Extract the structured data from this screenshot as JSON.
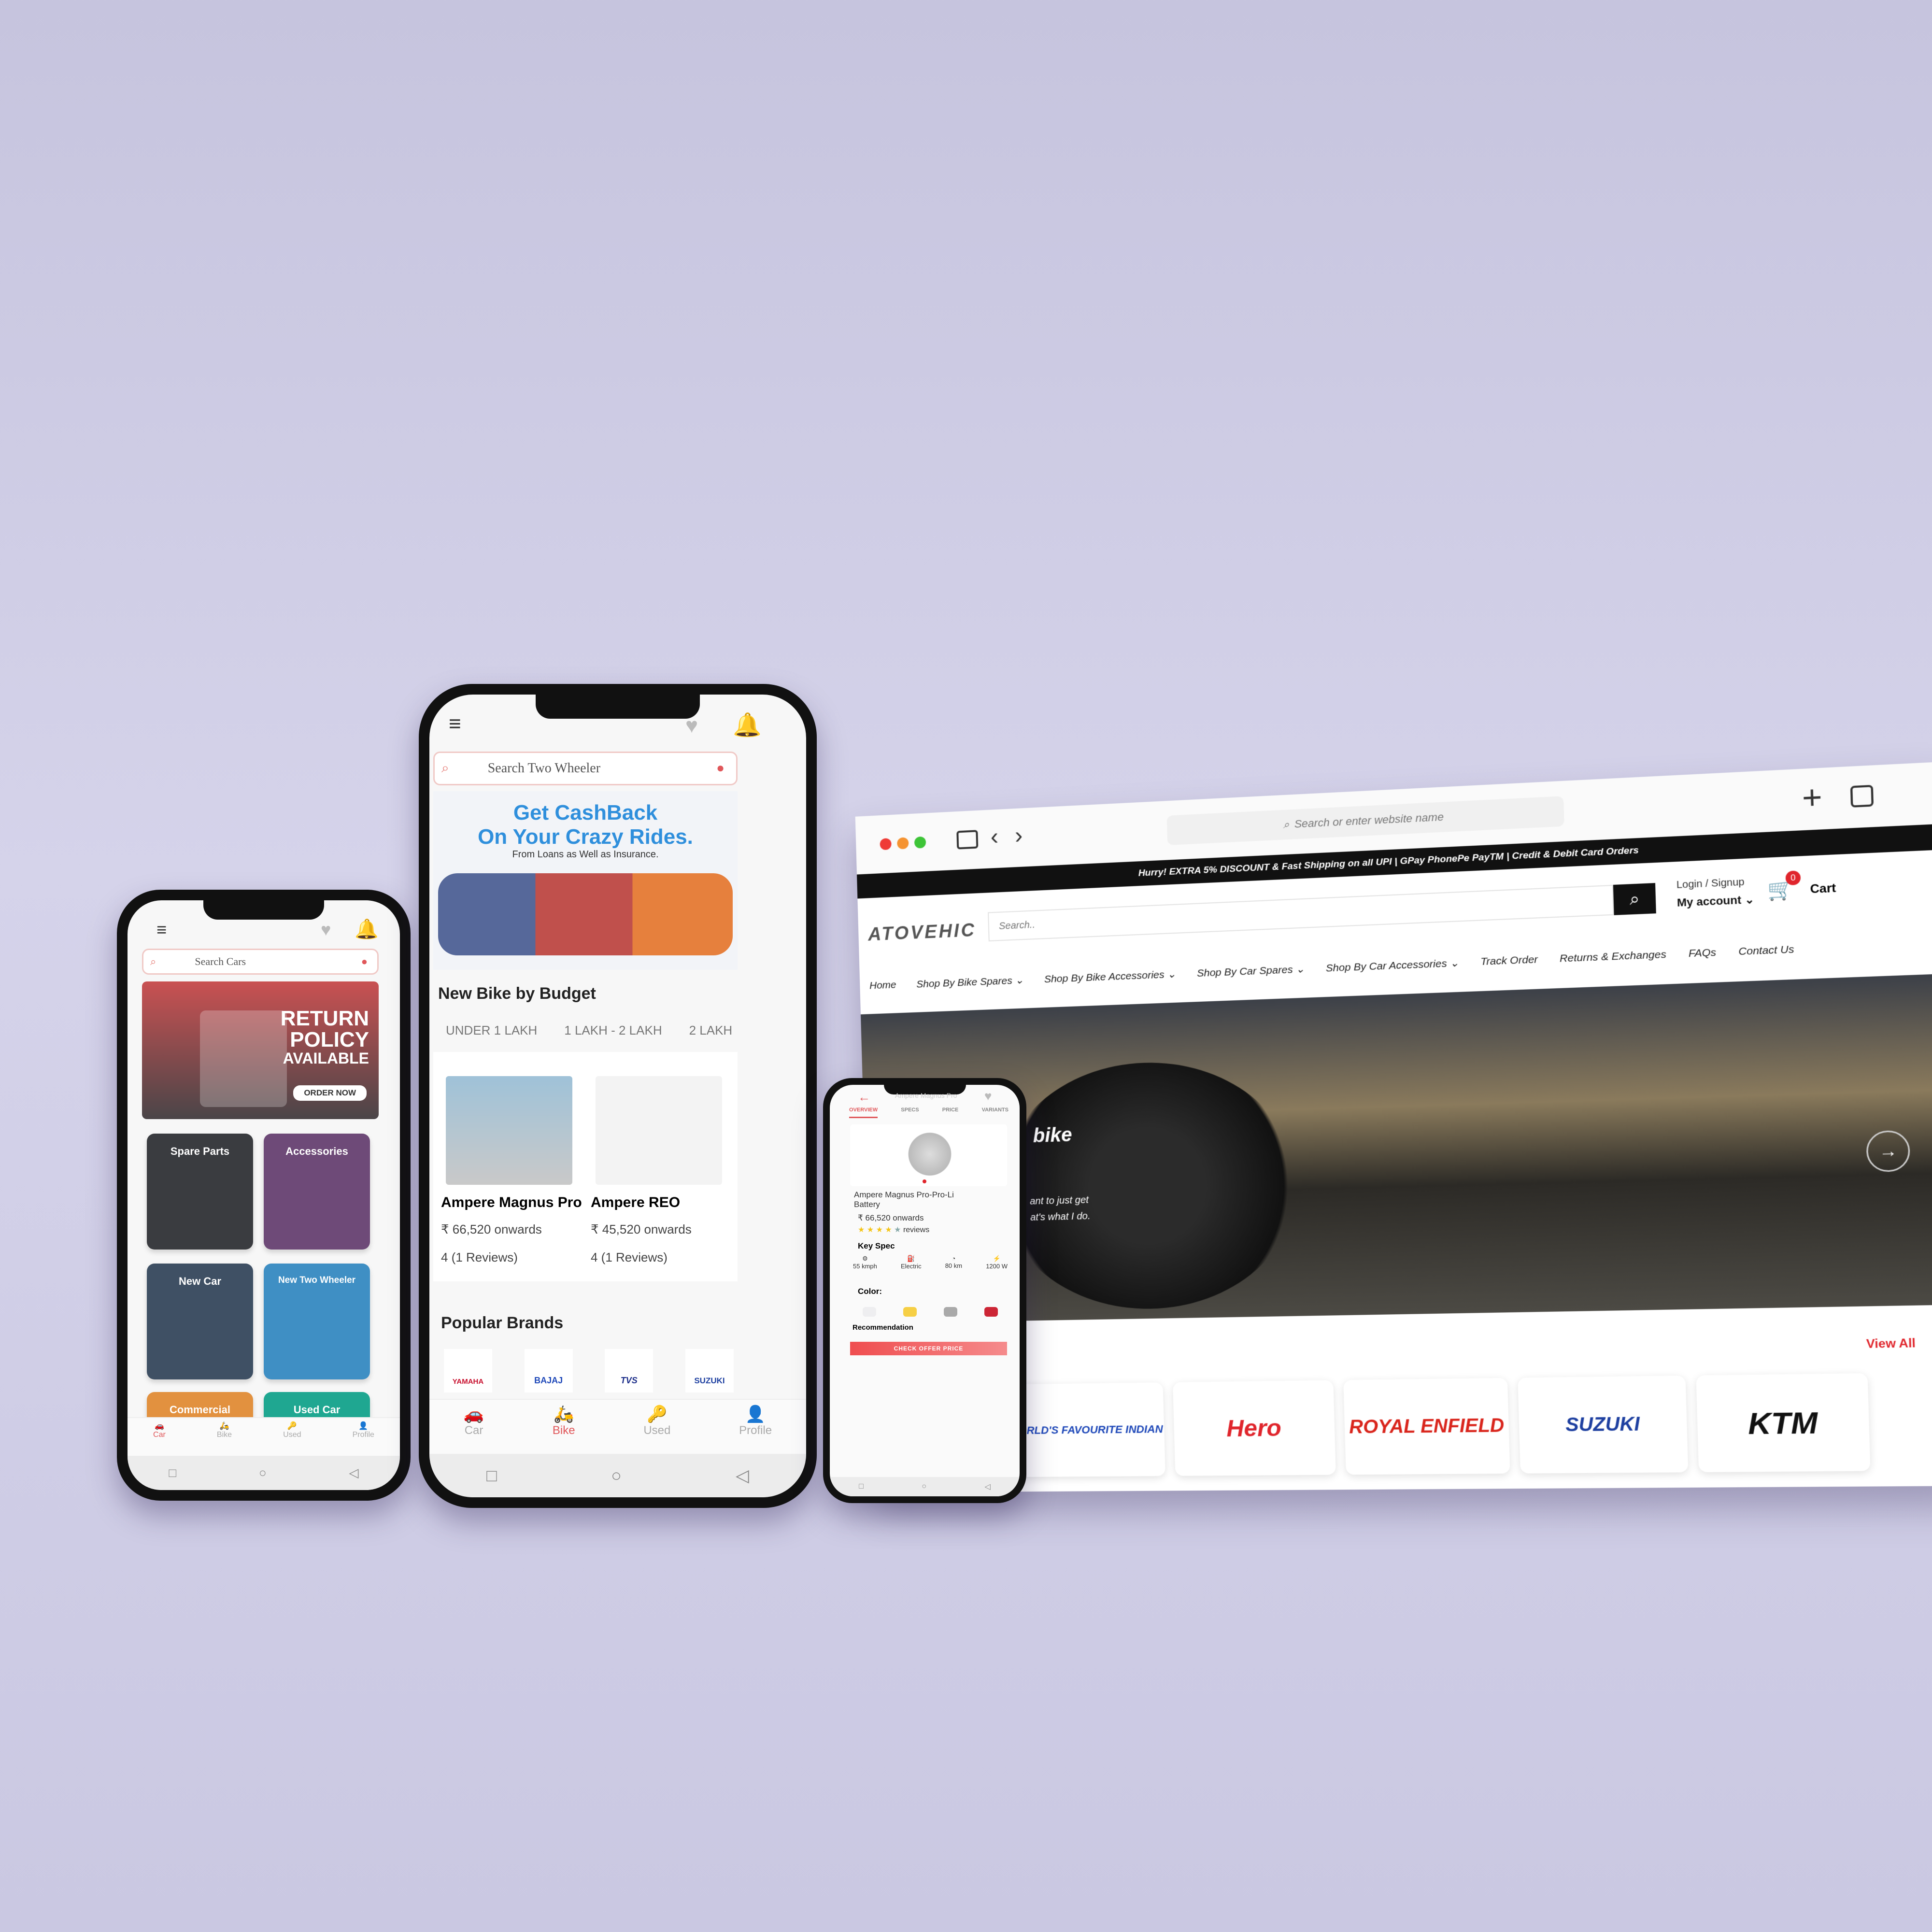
{
  "left_phone": {
    "search_placeholder": "Search Cars",
    "banner": {
      "line1": "RETURN",
      "line2": "POLICY",
      "line3": "AVAILABLE",
      "button": "ORDER NOW"
    },
    "tiles": [
      {
        "label": "Spare Parts",
        "color": "#3a3c40"
      },
      {
        "label": "Accessories",
        "color": "#6e4a78"
      },
      {
        "label": "New Car",
        "color": "#3f5064"
      },
      {
        "label": "New Two Wheeler",
        "color": "#3f8fc4"
      },
      {
        "label": "Commercial",
        "color": "#e2913f"
      },
      {
        "label": "Used Car",
        "color": "#1fa791"
      }
    ],
    "nav": [
      "Car",
      "Bike",
      "Used",
      "Profile"
    ],
    "active_nav": "Car"
  },
  "middle_phone": {
    "search_placeholder": "Search Two Wheeler",
    "banner": {
      "title1": "Get CashBack",
      "title2": "On Your Crazy Rides.",
      "subtitle": "From Loans as Well as Insurance."
    },
    "section_title": "New Bike by Budget",
    "budget_tabs": [
      "UNDER 1 LAKH",
      "1 LAKH - 2 LAKH",
      "2 LAKH"
    ],
    "bikes": [
      {
        "name": "Ampere Magnus Pro",
        "price": "₹ 66,520 onwards",
        "reviews": "4 (1 Reviews)"
      },
      {
        "name": "Ampere REO",
        "price": "₹ 45,520 onwards",
        "reviews": "4 (1 Reviews)"
      }
    ],
    "brands_title": "Popular Brands",
    "brands": [
      "YAMAHA",
      "BAJAJ",
      "TVS",
      "SUZUKI"
    ],
    "nav": [
      "Car",
      "Bike",
      "Used",
      "Profile"
    ],
    "active_nav": "Bike"
  },
  "small_phone": {
    "title": "Ampere Magnus Pro",
    "tabs": [
      "OVERVIEW",
      "SPECS",
      "PRICE",
      "VARIANTS"
    ],
    "active_tab": "OVERVIEW",
    "product_name": "Ampere Magnus Pro-Pro-Li Battery",
    "price": "₹ 66,520 onwards",
    "rating": 4,
    "reviews_label": "reviews",
    "key_spec_title": "Key Spec",
    "specs": [
      "55 kmph",
      "Electric",
      "80 km",
      "1200 W"
    ],
    "color_title": "Color:",
    "colors": [
      "#eeeef0",
      "#f6cf45",
      "#a9a9a9",
      "#cc2535"
    ],
    "recommendation": "Recommendation",
    "cta": "CHECK OFFER PRICE"
  },
  "browser": {
    "address_placeholder": "Search or enter website name",
    "announcement": "Hurry! EXTRA 5% DISCOUNT & Fast Shipping on all UPI | GPay PhonePe PayTM | Credit & Debit Card Orders",
    "logo": "ATOVEHIC",
    "search_placeholder": "Search..",
    "login": "Login / Signup",
    "account": "My account",
    "cart_label": "Cart",
    "cart_count": "0",
    "menu": [
      "Home",
      "Shop By Bike Spares",
      "Shop By Bike Accessories",
      "Shop By Car Spares",
      "Shop By Car Accessories",
      "Track Order",
      "Returns & Exchanges",
      "FAQs",
      "Contact Us"
    ],
    "hero_text": [
      "bike",
      "ant to just get",
      "at's what I do."
    ],
    "view_all": "View All",
    "brands": [
      "WORLD'S FAVOURITE INDIAN",
      "Hero",
      "ROYAL ENFIELD",
      "SUZUKI",
      "KTM"
    ],
    "accent": "#e0252c"
  }
}
